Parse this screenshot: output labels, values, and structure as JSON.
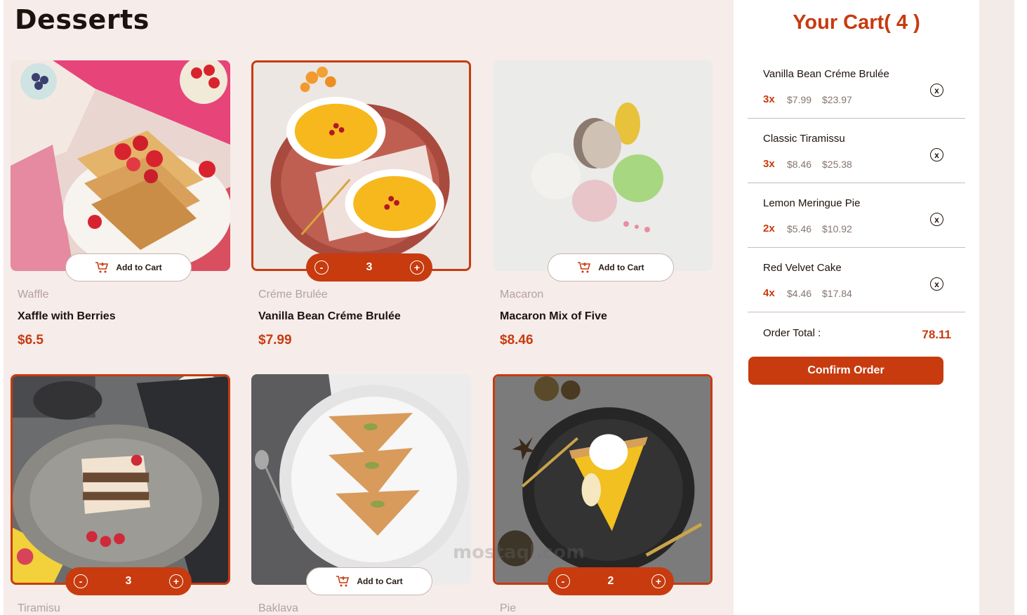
{
  "page": {
    "title": "Desserts"
  },
  "products": [
    {
      "category": "Waffle",
      "name": "Xaffle with Berries",
      "price": "$6.5",
      "in_cart": false,
      "quantity": "",
      "add_label": "Add to Cart",
      "image": "waffle"
    },
    {
      "category": "Créme Brulée",
      "name": "Vanilla Bean Créme Brulée",
      "price": "$7.99",
      "in_cart": true,
      "quantity": "3",
      "add_label": "",
      "image": "creme-brulee"
    },
    {
      "category": "Macaron",
      "name": "Macaron Mix of Five",
      "price": "$8.46",
      "in_cart": false,
      "quantity": "",
      "add_label": "Add to Cart",
      "image": "macaron"
    },
    {
      "category": "Tiramisu",
      "name": "",
      "price": "",
      "in_cart": true,
      "quantity": "3",
      "add_label": "",
      "image": "tiramisu"
    },
    {
      "category": "Baklava",
      "name": "",
      "price": "",
      "in_cart": false,
      "quantity": "",
      "add_label": "Add to Cart",
      "image": "baklava"
    },
    {
      "category": "Pie",
      "name": "",
      "price": "",
      "in_cart": true,
      "quantity": "2",
      "add_label": "",
      "image": "pie"
    }
  ],
  "controls": {
    "decrement": "-",
    "increment": "+"
  },
  "cart": {
    "title": "Your Cart( 4 )",
    "items": [
      {
        "name": "Vanilla Bean Créme Brulée",
        "qty": "3x",
        "unit_price": "$7.99",
        "line_total": "$23.97"
      },
      {
        "name": "Classic Tiramissu",
        "qty": "3x",
        "unit_price": "$8.46",
        "line_total": "$25.38"
      },
      {
        "name": "Lemon Meringue Pie",
        "qty": "2x",
        "unit_price": "$5.46",
        "line_total": "$10.92"
      },
      {
        "name": "Red Velvet Cake",
        "qty": "4x",
        "unit_price": "$4.46",
        "line_total": "$17.84"
      }
    ],
    "remove_glyph": "x",
    "order_total_label": "Order Total :",
    "order_total": "78.11",
    "confirm_label": "Confirm Order"
  },
  "watermark": "mostaql.com",
  "colors": {
    "accent": "#c73b0f",
    "background": "#f6ecea",
    "muted": "#b4a29c"
  }
}
